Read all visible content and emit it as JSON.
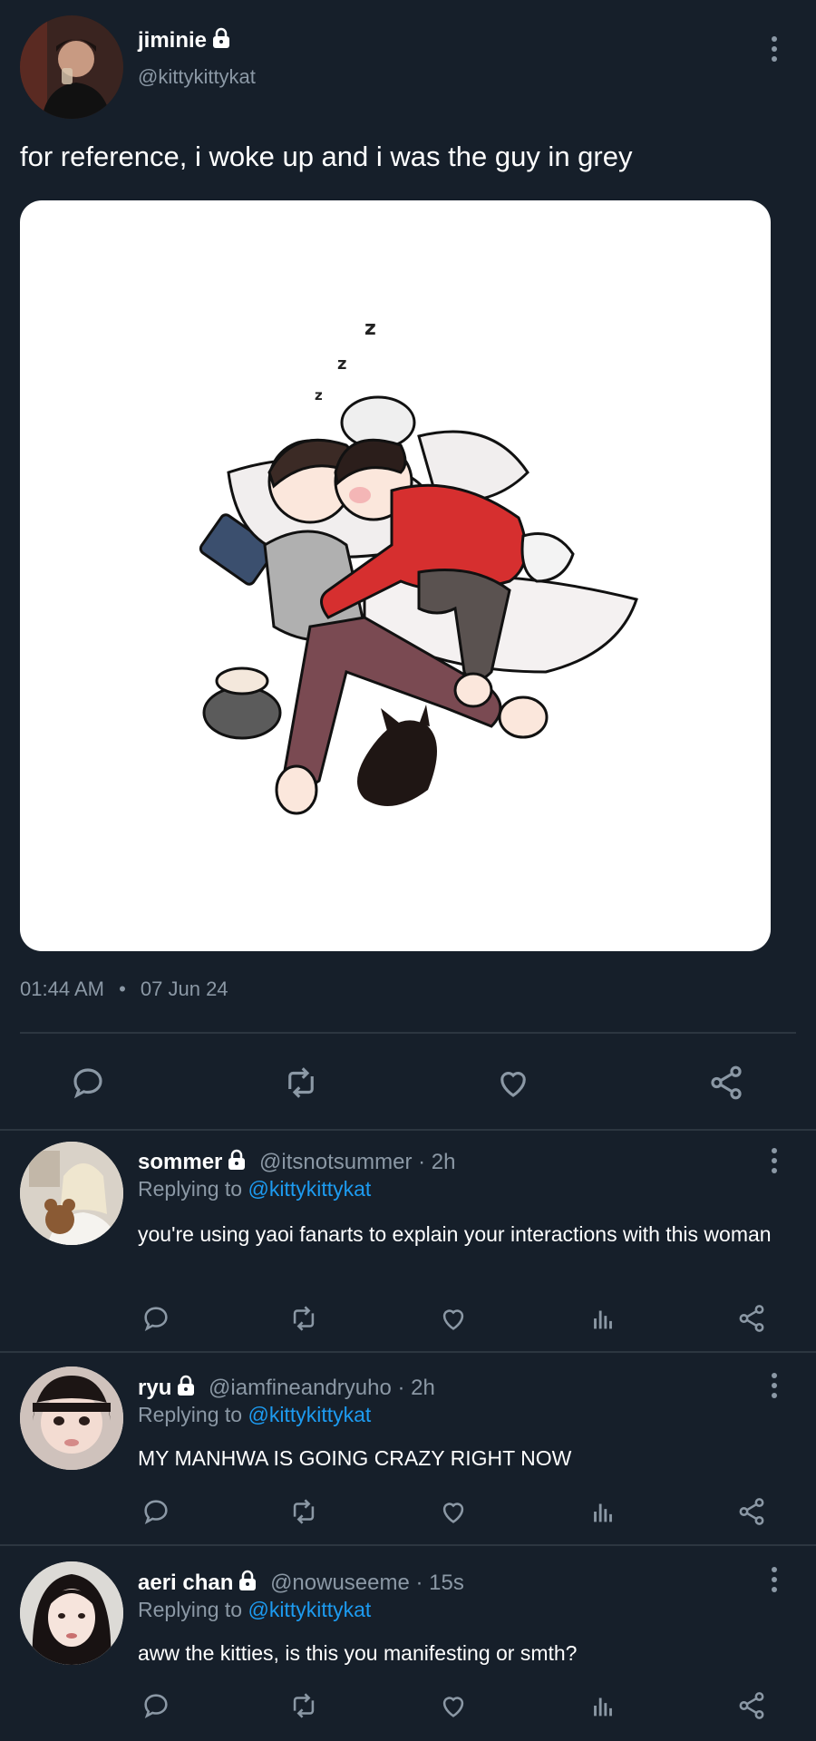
{
  "main_tweet": {
    "display_name": "jiminie",
    "handle": "@kittykittykat",
    "text": "for reference, i woke up and i was the guy in grey",
    "time": "01:44 AM",
    "separator": "•",
    "date": "07 Jun 24",
    "image_icons": [
      "lock-icon",
      "more-icon"
    ]
  },
  "action_icons": [
    "reply-icon",
    "retweet-icon",
    "like-icon",
    "analytics-icon",
    "share-icon"
  ],
  "replies": [
    {
      "display_name": "sommer",
      "meta": "@itsnotsummer · 2h",
      "replying_prefix": "Replying to",
      "replying_to": "@kittykittykat",
      "text": "you're using yaoi fanarts to explain your interactions with this woman"
    },
    {
      "display_name": "ryu",
      "meta": "@iamfineandryuho · 2h",
      "replying_prefix": "Replying to",
      "replying_to": "@kittykittykat",
      "text": "MY MANHWA IS GOING CRAZY RIGHT NOW"
    },
    {
      "display_name": "aeri chan",
      "meta": "@nowuseeme · 15s",
      "replying_prefix": "Replying to",
      "replying_to": "@kittykittykat",
      "text": "aww the kitties, is this you manifesting or smth?"
    }
  ],
  "colors": {
    "background": "#161f2a",
    "muted": "#8b98a5",
    "link": "#1d9bf0",
    "divider": "#2c3640"
  }
}
